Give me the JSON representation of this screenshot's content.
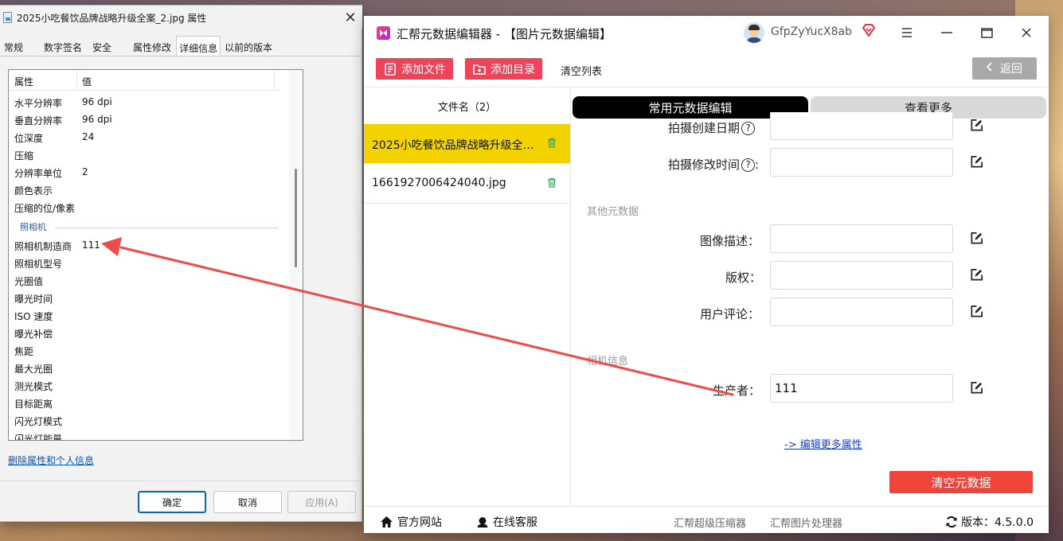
{
  "props_dialog": {
    "title": "2025小吃餐饮品牌战略升级全案_2.jpg 属性",
    "tabs": [
      "常规",
      "数字签名",
      "安全",
      "属性修改",
      "详细信息",
      "以前的版本"
    ],
    "active_tab": "详细信息",
    "columns": {
      "property": "属性",
      "value": "值"
    },
    "rows_image": [
      {
        "k": "水平分辨率",
        "v": "96 dpi"
      },
      {
        "k": "垂直分辨率",
        "v": "96 dpi"
      },
      {
        "k": "位深度",
        "v": "24"
      },
      {
        "k": "压缩",
        "v": ""
      },
      {
        "k": "分辨率单位",
        "v": "2"
      },
      {
        "k": "颜色表示",
        "v": ""
      },
      {
        "k": "压缩的位/像素",
        "v": ""
      }
    ],
    "group_camera": "照相机",
    "rows_camera": [
      {
        "k": "照相机制造商",
        "v": "111"
      },
      {
        "k": "照相机型号",
        "v": ""
      },
      {
        "k": "光圈值",
        "v": ""
      },
      {
        "k": "曝光时间",
        "v": ""
      },
      {
        "k": "ISO 速度",
        "v": ""
      },
      {
        "k": "曝光补偿",
        "v": ""
      },
      {
        "k": "焦距",
        "v": ""
      },
      {
        "k": "最大光圈",
        "v": ""
      },
      {
        "k": "测光模式",
        "v": ""
      },
      {
        "k": "目标距离",
        "v": ""
      },
      {
        "k": "闪光灯模式",
        "v": ""
      },
      {
        "k": "闪光灯能量",
        "v": ""
      }
    ],
    "remove_link": "删除属性和个人信息",
    "buttons": {
      "ok": "确定",
      "cancel": "取消",
      "apply": "应用(A)"
    }
  },
  "app": {
    "title": "汇帮元数据编辑器 - 【图片元数据编辑】",
    "username": "GfpZyYucX8ab",
    "toolbar": {
      "add_file": "添加文件",
      "add_dir": "添加目录",
      "clear_list": "清空列表",
      "back": "返回"
    },
    "file_list": {
      "header": "文件名（2）",
      "files": [
        {
          "name": "2025小吃餐饮品牌战略升级全案...",
          "selected": true
        },
        {
          "name": "1661927006424040.jpg",
          "selected": false
        }
      ]
    },
    "tabs": {
      "common": "常用元数据编辑",
      "more": "查看更多"
    },
    "fields": {
      "shoot_create_date": {
        "label": "拍摄创建日期",
        "value": ""
      },
      "shoot_modify_time": {
        "label": "拍摄修改时间",
        "value": ""
      },
      "image_desc": {
        "label": "图像描述：",
        "value": ""
      },
      "copyright": {
        "label": "版权：",
        "value": ""
      },
      "user_comment": {
        "label": "用户评论：",
        "value": ""
      },
      "producer": {
        "label": "生产者：",
        "value": "111"
      }
    },
    "sections": {
      "other": "其他元数据",
      "camera": "相机信息"
    },
    "more_attrs_link": "-> 编辑更多属性",
    "clear_metadata": "清空元数据",
    "footer": {
      "website": "官方网站",
      "support": "在线客服",
      "compressor": "汇帮超级压缩器",
      "image_tool": "汇帮图片处理器",
      "version": "版本：4.5.0.0"
    }
  },
  "colors": {
    "accent_pink": "#f0435a",
    "selected_yellow": "#f2d300",
    "annotation_arrow": "#ee4b4b"
  }
}
